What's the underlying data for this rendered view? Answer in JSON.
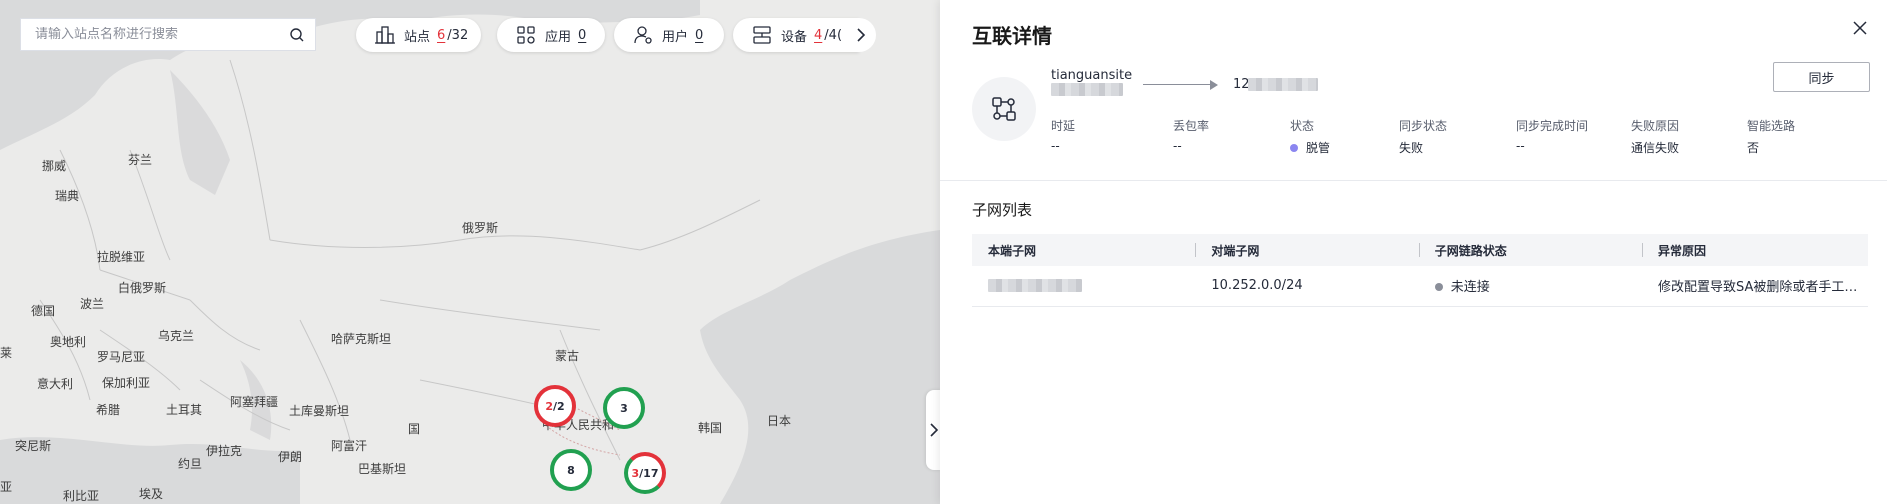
{
  "search": {
    "placeholder": "请输入站点名称进行搜索"
  },
  "stats": [
    {
      "label": "站点",
      "value": "6",
      "total": "/32",
      "value_color": "red",
      "icon": "building-icon"
    },
    {
      "label": "应用",
      "value": "0",
      "total": "",
      "value_color": "gray",
      "icon": "apps-grid-icon"
    },
    {
      "label": "用户",
      "value": "0",
      "total": "",
      "value_color": "gray",
      "icon": "user-gear-icon"
    },
    {
      "label": "设备",
      "value": "4",
      "total": "/4(",
      "value_color": "red",
      "icon": "device-icon"
    }
  ],
  "map": {
    "labels": [
      "挪威",
      "芬兰",
      "瑞典",
      "俄罗斯",
      "拉脱维亚",
      "白俄罗斯",
      "德国",
      "波兰",
      "乌克兰",
      "哈萨克斯坦",
      "奥地利",
      "罗马尼亚",
      "蒙古",
      "意大利",
      "保加利亚",
      "阿塞拜疆",
      "土耳其",
      "土库曼斯坦",
      "希腊",
      "韩国",
      "日本",
      "阿富汗",
      "突尼斯",
      "伊拉克",
      "伊朗",
      "约旦",
      "巴基斯坦",
      "利比亚",
      "埃及",
      "中华人民共和",
      "莱",
      "亚",
      "国"
    ],
    "clusters": [
      {
        "fault": "2",
        "total": "/2",
        "status": "red"
      },
      {
        "fault": "",
        "total": "3",
        "status": "green"
      },
      {
        "fault": "",
        "total": "8",
        "status": "green"
      },
      {
        "fault": "3",
        "total": "/17",
        "status": "mixed"
      }
    ]
  },
  "drawer": {
    "title": "互联详情",
    "sync_label": "同步",
    "local_site": "tianguansite",
    "remote_prefix": "12",
    "meta": [
      {
        "key": "时延",
        "value": "--"
      },
      {
        "key": "丢包率",
        "value": "--"
      },
      {
        "key": "状态",
        "value": "脱管",
        "dot_color": "#8b86f0"
      },
      {
        "key": "同步状态",
        "value": "失败"
      },
      {
        "key": "同步完成时间",
        "value": "--"
      },
      {
        "key": "失败原因",
        "value": "通信失败"
      },
      {
        "key": "智能选路",
        "value": "否"
      }
    ],
    "subnet_title": "子网列表",
    "table": {
      "headers": [
        "本端子网",
        "对端子网",
        "子网链路状态",
        "异常原因"
      ],
      "rows": [
        {
          "local": "",
          "remote": "10.252.0.0/24",
          "status": "未连接",
          "status_dot": "#8a8e99",
          "reason": "修改配置导致SA被删除或者手工删除SA"
        }
      ]
    }
  },
  "colors": {
    "fault": "#e3323a",
    "healthy": "#21a050",
    "accent": "#526ecc"
  }
}
